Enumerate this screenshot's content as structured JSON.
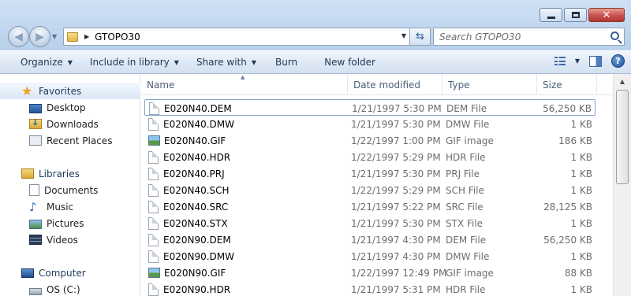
{
  "window": {
    "minimize_icon": "minimize-icon",
    "maximize_icon": "maximize-icon",
    "close_icon": "close-icon",
    "close_glyph": "✕"
  },
  "address": {
    "crumb_folder": "GTOPO30",
    "search_placeholder": "Search GTOPO30"
  },
  "toolbar": {
    "organize": "Organize",
    "include_in_library": "Include in library",
    "share_with": "Share with",
    "burn": "Burn",
    "new_folder": "New folder",
    "help_glyph": "?"
  },
  "navpane": {
    "favorites": "Favorites",
    "desktop": "Desktop",
    "downloads": "Downloads",
    "recent_places": "Recent Places",
    "libraries": "Libraries",
    "documents": "Documents",
    "music": "Music",
    "pictures": "Pictures",
    "videos": "Videos",
    "computer": "Computer",
    "os_c": "OS (C:)"
  },
  "columns": {
    "name": "Name",
    "date_modified": "Date modified",
    "type": "Type",
    "size": "Size"
  },
  "files": [
    {
      "name": "E020N40.DEM",
      "date": "1/21/1997 5:30 PM",
      "type": "DEM File",
      "size": "56,250 KB",
      "icon": "file"
    },
    {
      "name": "E020N40.DMW",
      "date": "1/21/1997 5:30 PM",
      "type": "DMW File",
      "size": "1 KB",
      "icon": "file"
    },
    {
      "name": "E020N40.GIF",
      "date": "1/22/1997 1:00 PM",
      "type": "GIF image",
      "size": "186 KB",
      "icon": "image"
    },
    {
      "name": "E020N40.HDR",
      "date": "1/22/1997 5:29 PM",
      "type": "HDR File",
      "size": "1 KB",
      "icon": "file"
    },
    {
      "name": "E020N40.PRJ",
      "date": "1/21/1997 5:30 PM",
      "type": "PRJ File",
      "size": "1 KB",
      "icon": "file"
    },
    {
      "name": "E020N40.SCH",
      "date": "1/22/1997 5:29 PM",
      "type": "SCH File",
      "size": "1 KB",
      "icon": "file"
    },
    {
      "name": "E020N40.SRC",
      "date": "1/21/1997 5:22 PM",
      "type": "SRC File",
      "size": "28,125 KB",
      "icon": "file"
    },
    {
      "name": "E020N40.STX",
      "date": "1/21/1997 5:30 PM",
      "type": "STX File",
      "size": "1 KB",
      "icon": "file"
    },
    {
      "name": "E020N90.DEM",
      "date": "1/21/1997 4:30 PM",
      "type": "DEM File",
      "size": "56,250 KB",
      "icon": "file"
    },
    {
      "name": "E020N90.DMW",
      "date": "1/21/1997 4:30 PM",
      "type": "DMW File",
      "size": "1 KB",
      "icon": "file"
    },
    {
      "name": "E020N90.GIF",
      "date": "1/22/1997 12:49 PM",
      "type": "GIF image",
      "size": "88 KB",
      "icon": "image"
    },
    {
      "name": "E020N90.HDR",
      "date": "1/21/1997 5:31 PM",
      "type": "HDR File",
      "size": "1 KB",
      "icon": "file"
    }
  ]
}
